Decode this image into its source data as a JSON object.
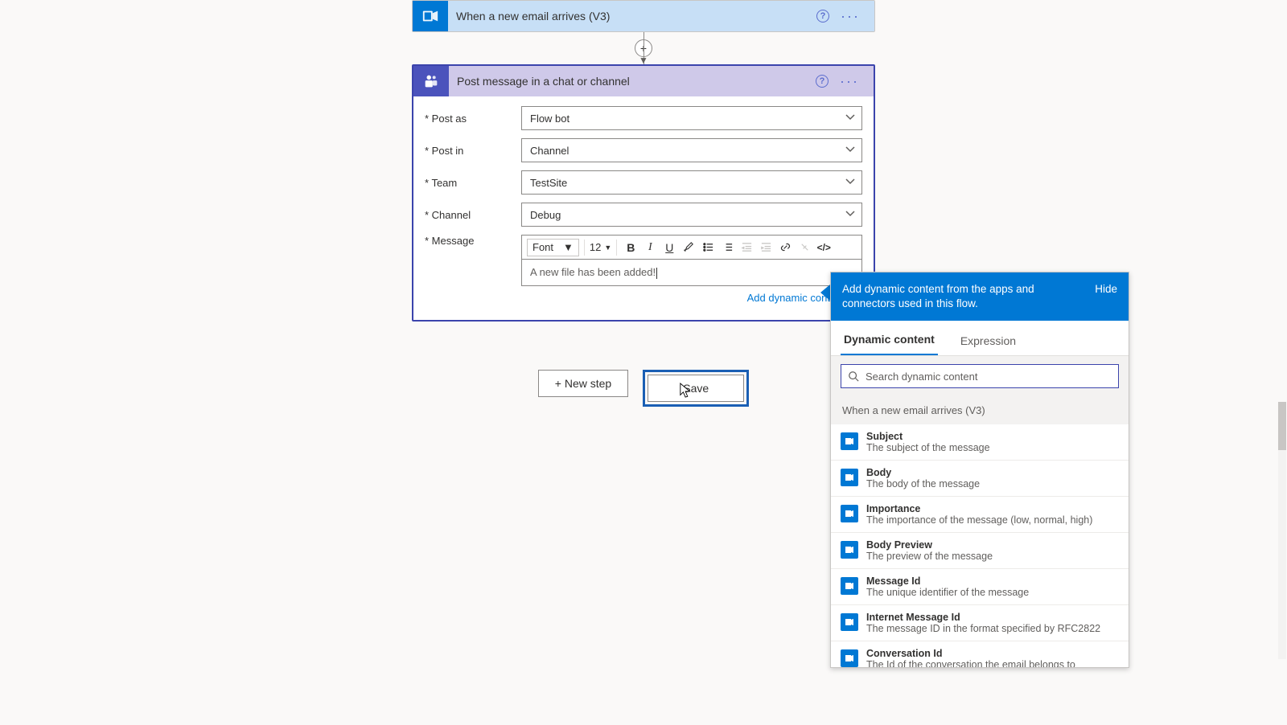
{
  "trigger": {
    "title": "When a new email arrives (V3)"
  },
  "action": {
    "title": "Post message in a chat or channel",
    "fields": {
      "post_as_label": "Post as",
      "post_as_value": "Flow bot",
      "post_in_label": "Post in",
      "post_in_value": "Channel",
      "team_label": "Team",
      "team_value": "TestSite",
      "channel_label": "Channel",
      "channel_value": "Debug",
      "message_label": "Message",
      "message_value": "A new file has been added!"
    },
    "rte": {
      "font_label": "Font",
      "size": "12"
    },
    "add_dc": "Add dynamic content"
  },
  "buttons": {
    "new_step": "+ New step",
    "save": "Save"
  },
  "dc": {
    "header": "Add dynamic content from the apps and connectors used in this flow.",
    "hide": "Hide",
    "tab_dc": "Dynamic content",
    "tab_expr": "Expression",
    "search_placeholder": "Search dynamic content",
    "section": "When a new email arrives (V3)",
    "items": [
      {
        "title": "Subject",
        "sub": "The subject of the message"
      },
      {
        "title": "Body",
        "sub": "The body of the message"
      },
      {
        "title": "Importance",
        "sub": "The importance of the message (low, normal, high)"
      },
      {
        "title": "Body Preview",
        "sub": "The preview of the message"
      },
      {
        "title": "Message Id",
        "sub": "The unique identifier of the message"
      },
      {
        "title": "Internet Message Id",
        "sub": "The message ID in the format specified by RFC2822"
      },
      {
        "title": "Conversation Id",
        "sub": "The Id of the conversation the email belongs to"
      }
    ]
  }
}
